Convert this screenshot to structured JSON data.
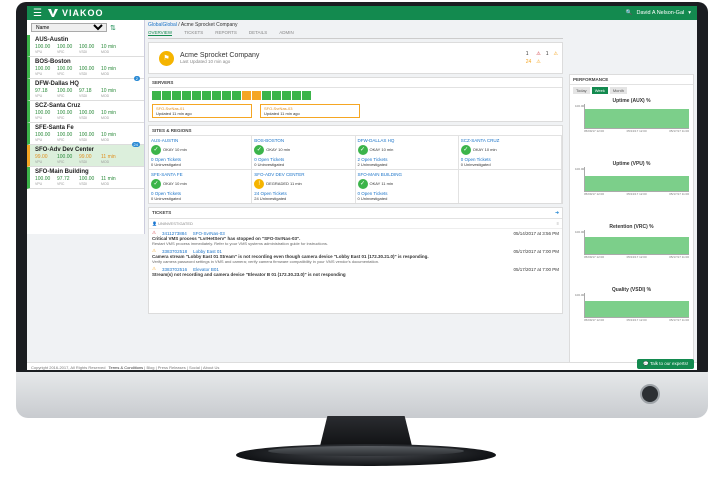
{
  "app": {
    "brand": "VIAKOO",
    "user": "David A Nelson-Gal"
  },
  "sidebar": {
    "filter_value": "Name",
    "column_labels": [
      "VPU",
      "VRC",
      "VSDI",
      "MOD"
    ],
    "sites": [
      {
        "name": "AUS-Austin",
        "values": [
          "100.00",
          "100.00",
          "100.00",
          "10 min"
        ]
      },
      {
        "name": "BOS-Boston",
        "values": [
          "100.00",
          "100.00",
          "100.00",
          "10 min"
        ]
      },
      {
        "name": "DFW-Dallas HQ",
        "values": [
          "97.18",
          "100.00",
          "97.18",
          "10 min"
        ],
        "badge": "2"
      },
      {
        "name": "SCZ-Santa Cruz",
        "values": [
          "100.00",
          "100.00",
          "100.00",
          "10 min"
        ]
      },
      {
        "name": "SFE-Santa Fe",
        "values": [
          "100.00",
          "100.00",
          "100.00",
          "10 min"
        ]
      },
      {
        "name": "SFO-Adv Dev Center",
        "values": [
          "99.00",
          "100.00",
          "99.00",
          "11 min"
        ],
        "badge": "24",
        "warn": true,
        "selected": true
      },
      {
        "name": "SFO-Main Building",
        "values": [
          "100.00",
          "97.72",
          "100.00",
          "11 min"
        ]
      }
    ]
  },
  "breadcrumb": {
    "root": "GlobalGlobal",
    "current": "Acme Sprocket Company"
  },
  "tabs": [
    "OVERVIEW",
    "TICKETS",
    "REPORTS",
    "DETAILS",
    "ADMIN"
  ],
  "summary": {
    "company": "Acme Sprocket Company",
    "updated": "Last Updated 10 min ago",
    "counts": [
      "1",
      "1",
      "24",
      "1"
    ]
  },
  "servers": {
    "title": "SERVERS",
    "boxes": [
      "g",
      "g",
      "g",
      "g",
      "g",
      "g",
      "g",
      "g",
      "g",
      "o",
      "o",
      "g",
      "g",
      "g",
      "g",
      "g"
    ],
    "left_name": "SFO-SvrNas-01",
    "left_updated": "Updated 11 min ago",
    "right_name": "SFO-SvrNas-03",
    "right_updated": "Updated 11 min ago"
  },
  "sites_regions": {
    "title": "SITES & REGIONS",
    "row1": [
      {
        "name": "AUS-AUSTIN",
        "status": "OKAY",
        "time": "10 min",
        "tickets": "0 Open Tickets",
        "uninvestigated": "0 Uninvestigated"
      },
      {
        "name": "BOS-BOSTON",
        "status": "OKAY",
        "time": "10 min",
        "tickets": "0 Open Tickets",
        "uninvestigated": "0 Uninvestigated"
      },
      {
        "name": "DFW-DALLAS HQ",
        "status": "OKAY",
        "time": "10 min",
        "tickets": "2 Open Tickets",
        "uninvestigated": "2 Uninvestigated"
      },
      {
        "name": "SCZ-SANTA CRUZ",
        "status": "OKAY",
        "time": "10 min",
        "tickets": "0 Open Tickets",
        "uninvestigated": "0 Uninvestigated"
      }
    ],
    "row2": [
      {
        "name": "SFE-SANTA FE",
        "status": "OKAY",
        "time": "10 min",
        "tickets": "0 Open Tickets",
        "uninvestigated": "0 Uninvestigated"
      },
      {
        "name": "SFO-ADV DEV CENTER",
        "status": "DEGRADED",
        "time": "11 min",
        "tickets": "24 Open Tickets",
        "uninvestigated": "24 Uninvestigated"
      },
      {
        "name": "SFO-MAIN BUILDING",
        "status": "OKAY",
        "time": "11 min",
        "tickets": "0 Open Tickets",
        "uninvestigated": "0 Uninvestigated"
      }
    ]
  },
  "tickets": {
    "title": "TICKETS",
    "filter": "UNINVESTIGATED",
    "list": [
      {
        "id": "3411273884",
        "device": "SFO-SvrNas-03",
        "date": "05/14/2017 at 3:56 PM",
        "title": "Critical VMS process \"LvrHetServ\" has stopped on \"SFO-SvrNas-03\".",
        "desc": "Restart VMS process immediately. Refer to your VMS systems administration guide for instructions."
      },
      {
        "id": "3383702518",
        "device": "Lobby East 01",
        "date": "05/17/2017 at 7:00 PM",
        "title": "Camera stream \"Lobby East 01 Stream\" is not recording even though camera device \"Lobby East 01 (172.30.21.0)\" is responding.",
        "desc": "Verify camera password settings in VMS and camera; verify camera firmware compatibility in your VMS vendor's documentation."
      },
      {
        "id": "3383702516",
        "device": "Elevator B01",
        "date": "05/17/2017 at 7:00 PM",
        "title": "Stream(s) not recording and camera device \"Elevator B 01 (172.30.23.0)\" is not responding",
        "desc": ""
      }
    ]
  },
  "performance": {
    "title": "PERFORMANCE",
    "range_tabs": [
      "Today",
      "Week",
      "Month"
    ],
    "charts": [
      {
        "title": "Uptime (AUX) %",
        "ymax": "100.00",
        "x": [
          "05/09/17 12:00",
          "05/13/17 12:00",
          "05/17/17 11:00"
        ],
        "level": 0.78
      },
      {
        "title": "Uptime (VPU) %",
        "ymax": "100.00",
        "x": [
          "05/09/17 12:00",
          "05/13/17 12:00",
          "05/17/17 11:00"
        ],
        "level": 0.62
      },
      {
        "title": "Retention (VRC) %",
        "ymax": "100.00",
        "x": [
          "05/09/17 12:00",
          "05/13/17 12:00",
          "05/17/17 11:00"
        ],
        "level": 0.72
      },
      {
        "title": "Quality (VSDI) %",
        "ymax": "100.00",
        "x": [
          "05/09/17 12:00",
          "05/13/17 12:00",
          "05/17/17 11:00"
        ],
        "level": 0.68
      }
    ]
  },
  "footer": {
    "copyright": "Copyright 2016-2017, All Rights Reserved",
    "links": [
      "Terms & Conditions",
      "Blog",
      "Press Releases",
      "Social",
      "About Us"
    ],
    "cta": "Talk to our experts!"
  }
}
